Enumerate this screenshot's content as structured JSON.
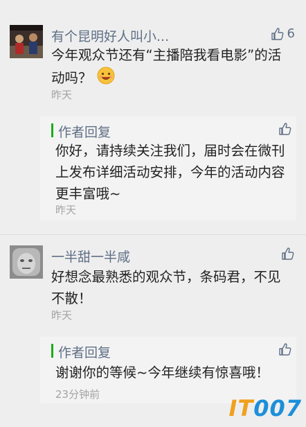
{
  "comments": [
    {
      "nickname": "有个昆明好人叫小...",
      "likes": "6",
      "text": "今年观众节还有“主播陪我看电影”的活动吗？",
      "time": "昨天",
      "emoji": "smiling-face-icon",
      "reply": {
        "label": "作者回复",
        "text": "你好，请持续关注我们，届时会在微刊上发布详细活动安排，今年的活动内容更丰富哦~",
        "time": "昨天"
      }
    },
    {
      "nickname": "一半甜一半咸",
      "likes": "",
      "text": "好想念最熟悉的观众节，条码君，不见不散！",
      "time": "昨天",
      "reply": {
        "label": "作者回复",
        "text": "谢谢你的等候~今年继续有惊喜哦！",
        "time": "23分钟前"
      }
    }
  ],
  "watermark": {
    "text_prefix": "IT",
    "text_suffix": "007"
  },
  "colors": {
    "accent_green": "#1aad19",
    "nickname": "#5f6f86",
    "timestamp": "#a3a3a3",
    "background": "#eeeeee"
  }
}
